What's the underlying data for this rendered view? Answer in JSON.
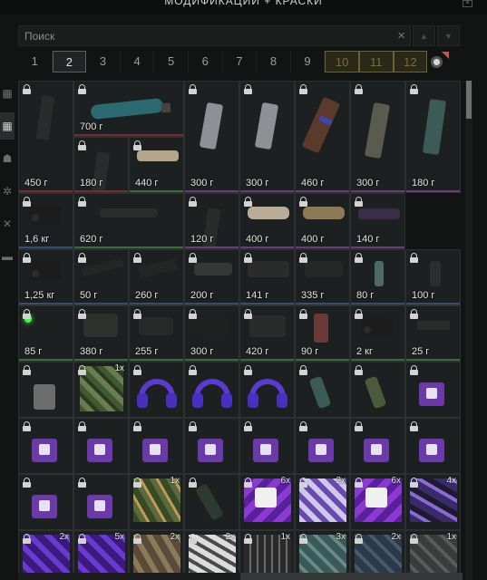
{
  "header": {
    "title": "МОДИФИКАЦИИ + КРАСКИ",
    "button": "×"
  },
  "search": {
    "placeholder": "Поиск",
    "value": "",
    "clear": "×",
    "up": "▲",
    "down": "▼"
  },
  "pages": [
    {
      "label": "1",
      "state": "normal"
    },
    {
      "label": "2",
      "state": "active"
    },
    {
      "label": "3",
      "state": "normal"
    },
    {
      "label": "4",
      "state": "normal"
    },
    {
      "label": "5",
      "state": "normal"
    },
    {
      "label": "6",
      "state": "normal"
    },
    {
      "label": "7",
      "state": "normal"
    },
    {
      "label": "8",
      "state": "normal"
    },
    {
      "label": "9",
      "state": "normal"
    },
    {
      "label": "10",
      "state": "gold"
    },
    {
      "label": "11",
      "state": "gold"
    },
    {
      "label": "12",
      "state": "gold"
    }
  ],
  "sidebar": [
    {
      "icon": "grid-small-icon",
      "glyph": "▦",
      "active": false
    },
    {
      "icon": "grid-large-icon",
      "glyph": "▦",
      "active": true
    },
    {
      "icon": "helmet-icon",
      "glyph": "☗",
      "active": false
    },
    {
      "icon": "gear-cog-icon",
      "glyph": "✲",
      "active": false
    },
    {
      "icon": "wrench-icon",
      "glyph": "✕",
      "active": false
    },
    {
      "icon": "box-icon",
      "glyph": "▬",
      "active": false
    }
  ],
  "grid": {
    "rows": [
      [
        {
          "icon": "magazine-dark-icon",
          "weight": "450 г",
          "color": "red"
        },
        {
          "icon": "gas-cylinder-icon",
          "weight": "700 г",
          "color": "red",
          "wide": true
        },
        {
          "icon": "magazine-wrapped-icon",
          "weight": "300 г",
          "color": "purple"
        },
        {
          "icon": "magazine-wrapped-icon",
          "weight": "300 г",
          "color": "purple"
        },
        {
          "icon": "magazine-banana-icon",
          "weight": "460 г",
          "color": "purple"
        },
        {
          "icon": "magazine-grey-icon",
          "weight": "300 г",
          "color": "purple"
        },
        {
          "icon": "magazine-teal-icon",
          "weight": "180 г",
          "color": "purple"
        }
      ],
      [
        {
          "icon": "magazine-dark-icon",
          "weight": "180 г",
          "color": "red"
        },
        {
          "icon": "scope-tan-icon",
          "weight": "440 г",
          "color": "green"
        }
      ],
      [
        {
          "icon": "night-vision-icon",
          "weight": "1,6 кг",
          "color": "blue"
        },
        {
          "icon": "pso-scope-icon",
          "weight": "620 г",
          "color": "green",
          "wide": true
        },
        {
          "icon": "magazine-dark-icon",
          "weight": "120 г",
          "color": "purple"
        },
        {
          "icon": "silencer-tan-icon",
          "weight": "400 г",
          "color": "purple"
        },
        {
          "icon": "silencer-brown-icon",
          "weight": "400 г",
          "color": "purple"
        },
        {
          "icon": "brake-purple-icon",
          "weight": "140 г",
          "color": "purple"
        }
      ],
      [
        {
          "icon": "night-vision-icon",
          "weight": "1,25 кг",
          "color": "blue"
        },
        {
          "icon": "rail-icon",
          "weight": "50 г",
          "color": "blue"
        },
        {
          "icon": "mount-icon",
          "weight": "260 г",
          "color": "blue"
        },
        {
          "icon": "muzzle-icon",
          "weight": "200 г",
          "color": "blue"
        },
        {
          "icon": "handguard-icon",
          "weight": "141 г",
          "color": "blue"
        },
        {
          "icon": "scope-dark-icon",
          "weight": "335 г",
          "color": "blue"
        },
        {
          "icon": "grip-teal-icon",
          "weight": "80 г",
          "color": "blue"
        },
        {
          "icon": "grip-icon",
          "weight": "100 г",
          "color": "blue"
        }
      ],
      [
        {
          "icon": "laser-icon",
          "weight": "85 г",
          "color": "green"
        },
        {
          "icon": "holo-sight-icon",
          "weight": "380 г",
          "color": "green"
        },
        {
          "icon": "red-dot-icon",
          "weight": "255 г",
          "color": "green"
        },
        {
          "icon": "collimator-icon",
          "weight": "300 г",
          "color": "green"
        },
        {
          "icon": "sight-box-icon",
          "weight": "420 г",
          "color": "green"
        },
        {
          "icon": "grip-red-icon",
          "weight": "90 г",
          "color": "green"
        },
        {
          "icon": "night-vision-icon",
          "weight": "2 кг",
          "color": "green"
        },
        {
          "icon": "rail-short-icon",
          "weight": "25 г",
          "color": "green"
        }
      ],
      [
        {
          "icon": "charm-skull-icon"
        },
        {
          "icon": "camo-paint-icon",
          "count": "1x"
        },
        {
          "icon": "headphones-purple-icon"
        },
        {
          "icon": "headphones-purple-icon"
        },
        {
          "icon": "headphones-purple-icon"
        },
        {
          "icon": "charm-teal-icon"
        },
        {
          "icon": "charm-green-icon"
        },
        {
          "icon": "twitch-charm-icon"
        }
      ],
      [
        {
          "icon": "twitch-charm-icon"
        },
        {
          "icon": "twitch-charm-icon"
        },
        {
          "icon": "twitch-charm-icon"
        },
        {
          "icon": "twitch-charm-icon"
        },
        {
          "icon": "twitch-charm-icon"
        },
        {
          "icon": "twitch-charm-icon"
        },
        {
          "icon": "twitch-charm-icon"
        },
        {
          "icon": "twitch-charm-icon"
        }
      ],
      [
        {
          "icon": "twitch-charm-icon"
        },
        {
          "icon": "twitch-charm-icon"
        },
        {
          "icon": "camo-jungle-icon",
          "count": "1x"
        },
        {
          "icon": "charm-bottle-icon"
        },
        {
          "icon": "twitch-paint-icon",
          "count": "6x"
        },
        {
          "icon": "pattern-paint-icon",
          "count": "2x"
        },
        {
          "icon": "twitch-paint-icon",
          "count": "6x"
        },
        {
          "icon": "purple-camo-icon",
          "count": "4x"
        }
      ],
      [
        {
          "icon": "paint-purple-icon",
          "count": "2x"
        },
        {
          "icon": "paint-purple-icon",
          "count": "5x"
        },
        {
          "icon": "paint-camo-icon",
          "count": "2x"
        },
        {
          "icon": "paint-white-icon",
          "count": "2x"
        },
        {
          "icon": "paint-text-icon",
          "count": "1x"
        },
        {
          "icon": "paint-teal-icon",
          "count": "3x"
        },
        {
          "icon": "paint-blue-icon",
          "count": "2x"
        },
        {
          "icon": "paint-grey-icon",
          "count": "1x"
        }
      ]
    ]
  }
}
